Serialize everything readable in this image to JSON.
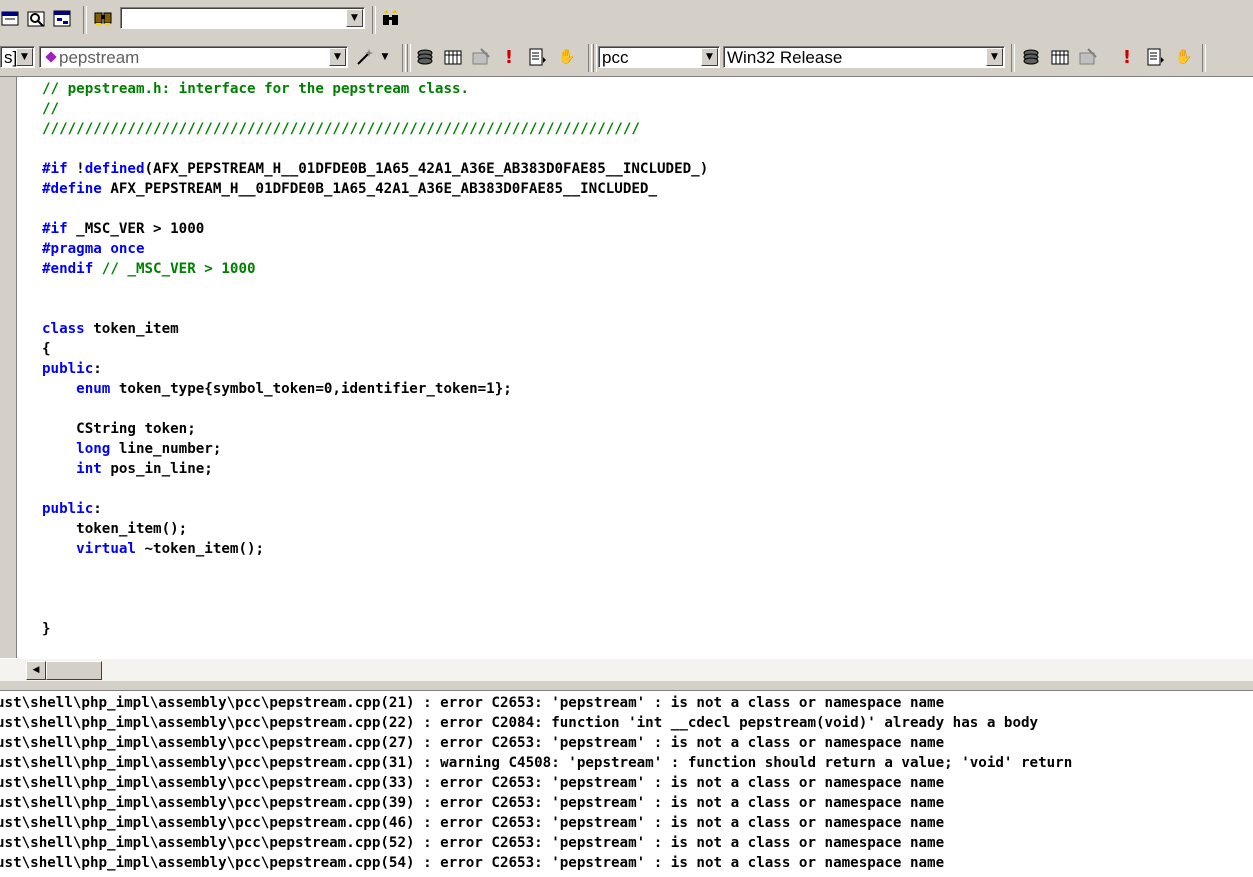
{
  "toolbar_top": {
    "find_combo_value": "",
    "icons": [
      "window-list-icon",
      "find-in-files-icon",
      "workspace-icon",
      "find-icon",
      "search-binoculars-icon"
    ]
  },
  "toolbar_wizard": {
    "class_combo_value": "s]",
    "member_combo_value": "pepstream",
    "member_icon": "purple-diamond-icon",
    "wand_icon": "magic-wand-icon"
  },
  "toolbar_build": {
    "project_combo_value": "pcc",
    "config_combo_value": "Win32 Release",
    "icons": [
      "compile-icon",
      "build-icon",
      "stop-build-icon",
      "execute-icon",
      "breakpoint-icon",
      "hand-icon"
    ]
  },
  "editor": {
    "lines": [
      [
        {
          "t": "// pepstream.h: interface for the pepstream class.",
          "c": "cmt"
        }
      ],
      [
        {
          "t": "//",
          "c": "cmt"
        }
      ],
      [
        {
          "t": "//////////////////////////////////////////////////////////////////////",
          "c": "cmt"
        }
      ],
      [
        {
          "t": ""
        }
      ],
      [
        {
          "t": "#if",
          "c": "kw"
        },
        {
          "t": " !"
        },
        {
          "t": "defined",
          "c": "kw"
        },
        {
          "t": "(AFX_PEPSTREAM_H__01DFDE0B_1A65_42A1_A36E_AB383D0FAE85__INCLUDED_)"
        }
      ],
      [
        {
          "t": "#define",
          "c": "kw"
        },
        {
          "t": " AFX_PEPSTREAM_H__01DFDE0B_1A65_42A1_A36E_AB383D0FAE85__INCLUDED_"
        }
      ],
      [
        {
          "t": ""
        }
      ],
      [
        {
          "t": "#if",
          "c": "kw"
        },
        {
          "t": " _MSC_VER > 1000"
        }
      ],
      [
        {
          "t": "#pragma once",
          "c": "kw"
        }
      ],
      [
        {
          "t": "#endif",
          "c": "kw"
        },
        {
          "t": " // _MSC_VER > 1000",
          "c": "cmt"
        }
      ],
      [
        {
          "t": ""
        }
      ],
      [
        {
          "t": ""
        }
      ],
      [
        {
          "t": "class",
          "c": "kw"
        },
        {
          "t": " token_item"
        }
      ],
      [
        {
          "t": "{"
        }
      ],
      [
        {
          "t": "public",
          "c": "kw"
        },
        {
          "t": ":"
        }
      ],
      [
        {
          "t": "    "
        },
        {
          "t": "enum",
          "c": "kw"
        },
        {
          "t": " token_type{symbol_token=0,identifier_token=1};"
        }
      ],
      [
        {
          "t": ""
        }
      ],
      [
        {
          "t": "    CString token;"
        }
      ],
      [
        {
          "t": "    "
        },
        {
          "t": "long",
          "c": "kw"
        },
        {
          "t": " line_number;"
        }
      ],
      [
        {
          "t": "    "
        },
        {
          "t": "int",
          "c": "kw"
        },
        {
          "t": " pos_in_line;"
        }
      ],
      [
        {
          "t": ""
        }
      ],
      [
        {
          "t": "public",
          "c": "kw"
        },
        {
          "t": ":"
        }
      ],
      [
        {
          "t": "    token_item();"
        }
      ],
      [
        {
          "t": "    "
        },
        {
          "t": "virtual",
          "c": "kw"
        },
        {
          "t": " ~token_item();"
        }
      ],
      [
        {
          "t": ""
        }
      ],
      [
        {
          "t": ""
        }
      ],
      [
        {
          "t": ""
        }
      ],
      [
        {
          "t": "}"
        }
      ]
    ]
  },
  "output": {
    "lines": [
      "ust\\shell\\php_impl\\assembly\\pcc\\pepstream.cpp(21) : error C2653: 'pepstream' : is not a class or namespace name",
      "ust\\shell\\php_impl\\assembly\\pcc\\pepstream.cpp(22) : error C2084: function 'int __cdecl pepstream(void)' already has a body",
      "ust\\shell\\php_impl\\assembly\\pcc\\pepstream.cpp(27) : error C2653: 'pepstream' : is not a class or namespace name",
      "ust\\shell\\php_impl\\assembly\\pcc\\pepstream.cpp(31) : warning C4508: 'pepstream' : function should return a value; 'void' return",
      "ust\\shell\\php_impl\\assembly\\pcc\\pepstream.cpp(33) : error C2653: 'pepstream' : is not a class or namespace name",
      "ust\\shell\\php_impl\\assembly\\pcc\\pepstream.cpp(39) : error C2653: 'pepstream' : is not a class or namespace name",
      "ust\\shell\\php_impl\\assembly\\pcc\\pepstream.cpp(46) : error C2653: 'pepstream' : is not a class or namespace name",
      "ust\\shell\\php_impl\\assembly\\pcc\\pepstream.cpp(52) : error C2653: 'pepstream' : is not a class or namespace name",
      "ust\\shell\\php_impl\\assembly\\pcc\\pepstream.cpp(54) : error C2653: 'pepstream' : is not a class or namespace name"
    ]
  },
  "colors": {
    "comment": "#008000",
    "keyword": "#0000ff",
    "chrome": "#d4d0c8",
    "error_icon": "#cc0000"
  }
}
